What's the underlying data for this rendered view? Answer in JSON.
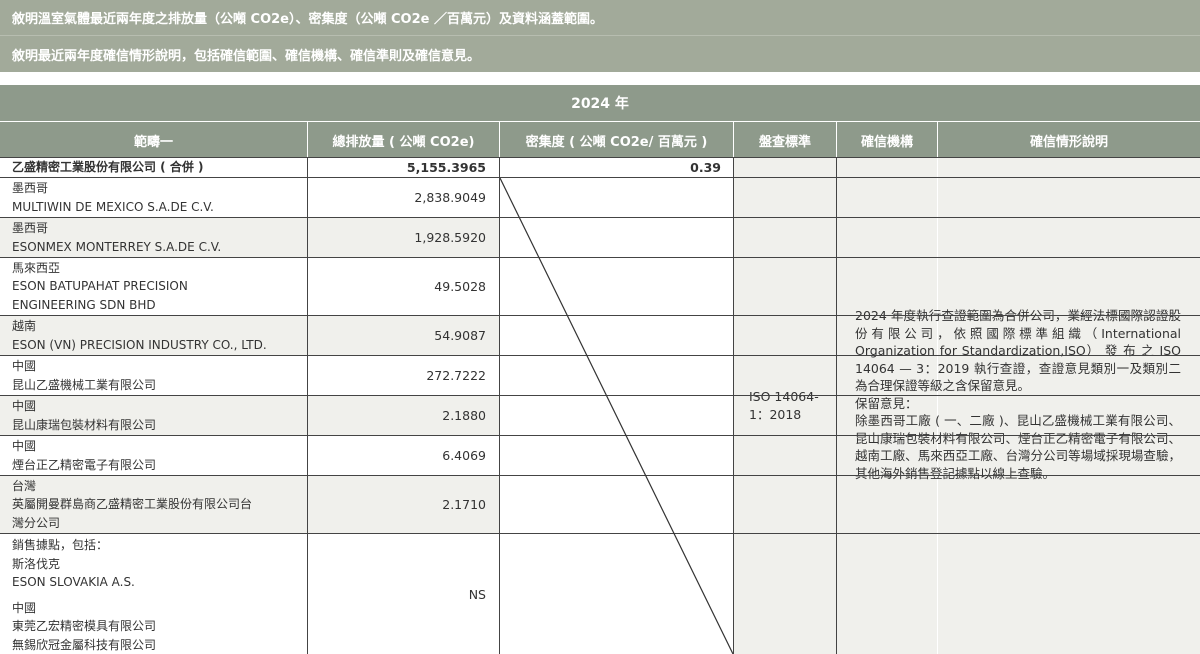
{
  "header": {
    "line1": "敘明溫室氣體最近兩年度之排放量（公噸 CO2e）、密集度（公噸 CO2e ／百萬元）及資料涵蓋範圍。",
    "line2": "敘明最近兩年度確信情形說明，包括確信範圍、確信機構、確信準則及確信意見。"
  },
  "table": {
    "year": "2024 年",
    "columns": [
      "範疇一",
      "總排放量 ( 公噸 CO2e)",
      "密集度 ( 公噸 CO2e/ 百萬元 )",
      "盤查標準",
      "確信機構",
      "確信情形說明"
    ],
    "rows": [
      {
        "lines": [
          "乙盛精密工業股份有限公司 ( 合併 )"
        ],
        "emission": "5,155.3965",
        "intensity": "0.39"
      },
      {
        "lines": [
          "墨西哥",
          "MULTIWIN DE MEXICO S.A.DE C.V."
        ],
        "emission": "2,838.9049"
      },
      {
        "lines": [
          "墨西哥",
          "ESONMEX MONTERREY S.A.DE C.V."
        ],
        "emission": "1,928.5920"
      },
      {
        "lines": [
          "馬來西亞",
          "ESON BATUPAHAT PRECISION",
          "ENGINEERING SDN BHD"
        ],
        "emission": "49.5028"
      },
      {
        "lines": [
          "越南",
          "ESON (VN) PRECISION INDUSTRY CO., LTD."
        ],
        "emission": "54.9087"
      },
      {
        "lines": [
          "中國",
          "昆山乙盛機械工業有限公司"
        ],
        "emission": "272.7222"
      },
      {
        "lines": [
          "中國",
          "昆山康瑞包裝材料有限公司"
        ],
        "emission": "2.1880"
      },
      {
        "lines": [
          "中國",
          "煙台正乙精密電子有限公司"
        ],
        "emission": "6.4069"
      },
      {
        "lines": [
          "台灣",
          "英屬開曼群島商乙盛精密工業股份有限公司台",
          "灣分公司"
        ],
        "emission": "2.1710"
      },
      {
        "lines": [
          "銷售據點，包括：",
          "斯洛伐克",
          "ESON SLOVAKIA A.S.",
          "",
          "中國",
          "東莞乙宏精密模具有限公司",
          "無錫欣冠金屬科技有限公司"
        ],
        "emission": "NS"
      }
    ],
    "standard": "ISO 14064-1：2018",
    "assurance_org": "",
    "description": [
      "2024 年度執行查證範圍為合併公司，業經法標國際認證股份有限公司，依照國際標準組織（International Organization for Standardization,ISO） 發 布 之 ISO 14064 — 3：2019 執行查證，查證意見類別一及類別二為合理保證等級之含保留意見。",
      "保留意見：",
      "除墨西哥工廠 ( 一、二廠 )、昆山乙盛機械工業有限公司、昆山康瑞包裝材料有限公司、煙台正乙精密電子有限公司、越南工廠、馬來西亞工廠、台灣分公司等場域採現場查驗，其他海外銷售登記據點以線上查驗。"
    ]
  }
}
